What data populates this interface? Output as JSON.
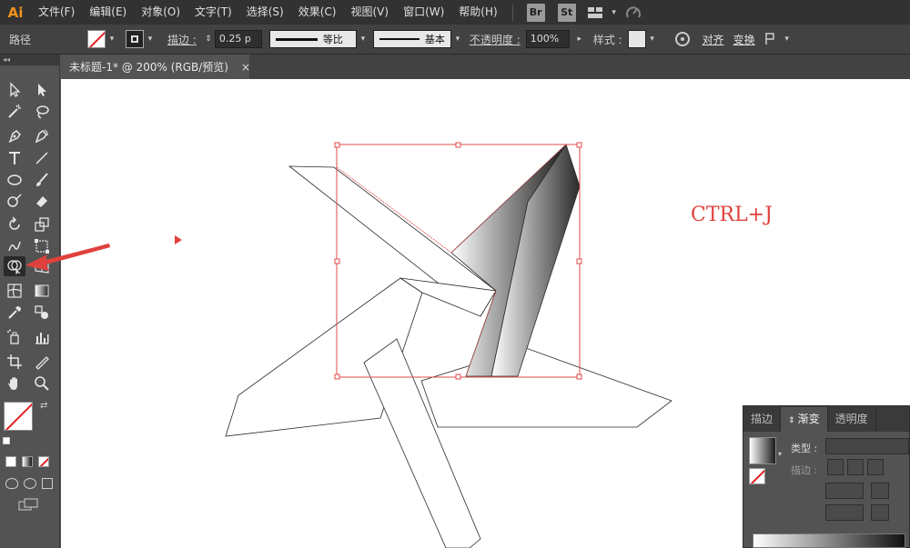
{
  "app": {
    "logo": "Ai"
  },
  "menu": [
    "文件(F)",
    "编辑(E)",
    "对象(O)",
    "文字(T)",
    "选择(S)",
    "效果(C)",
    "视图(V)",
    "窗口(W)",
    "帮助(H)"
  ],
  "menu_apps": [
    "Br",
    "St"
  ],
  "control_bar": {
    "object_type": "路径",
    "stroke_label": "描边 :",
    "stroke_weight": "0.25 p",
    "profile_label": "等比",
    "brush_label": "基本",
    "opacity_label": "不透明度 :",
    "opacity_value": "100%",
    "style_label": "样式 :",
    "align_label": "对齐",
    "transform_label": "变换"
  },
  "toolbox": {
    "collapse_glyph": "◂◂"
  },
  "document": {
    "tab_title": "未标题-1* @ 200% (RGB/预览)",
    "close_glyph": "×"
  },
  "annotation": "CTRL+J",
  "panel": {
    "tabs": [
      "描边",
      "渐变",
      "透明度"
    ],
    "active_tab": "渐变",
    "type_label": "类型 :",
    "stroke_label": "描边 :"
  },
  "colors": {
    "accent_red": "#e0413d",
    "selection_red": "#e04848",
    "menu_bg": "#323232",
    "ui_bg": "#535353",
    "logo_orange": "#f7941d"
  },
  "icons": [
    "selection-icon",
    "direct-selection-icon",
    "magic-wand-icon",
    "lasso-icon",
    "pen-icon",
    "curvature-icon",
    "type-icon",
    "line-icon",
    "ellipse-icon",
    "paintbrush-icon",
    "shaper-icon",
    "eraser-icon",
    "rotate-icon",
    "scale-icon",
    "warp-icon",
    "free-transform-icon",
    "shape-builder-icon",
    "perspective-icon",
    "mesh-icon",
    "gradient-icon",
    "eyedropper-icon",
    "blend-icon",
    "symbol-sprayer-icon",
    "graph-icon",
    "artboard-icon",
    "slice-icon",
    "hand-icon",
    "zoom-icon"
  ]
}
